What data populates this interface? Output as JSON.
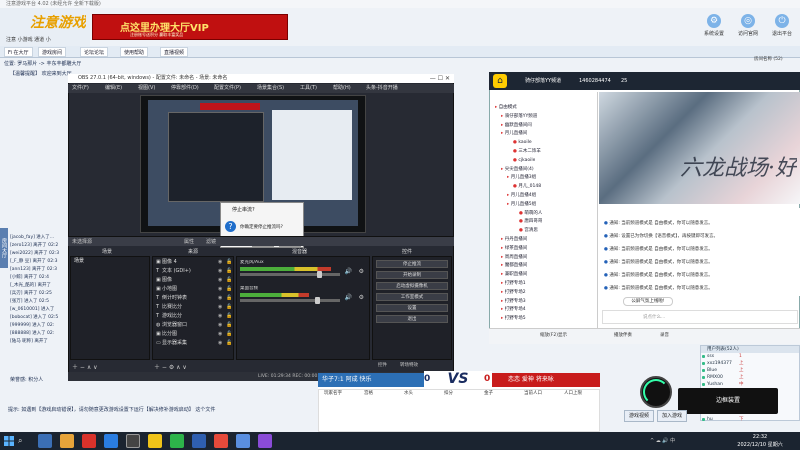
{
  "app": {
    "title": "注意游戏平台 4.02 (未经允许 全新下载版)",
    "logo_text": "注意游戏",
    "logo_sub": "注意 小游戏 通道 小",
    "banner_text": "点这里办理大厅VIP",
    "banner_sub": "注册账号送积分 赢取丰富奖品"
  },
  "topbar": {
    "icons": [
      {
        "label": "系统设置",
        "icon": "gear-icon"
      },
      {
        "label": "访问官网",
        "icon": "globe-icon"
      },
      {
        "label": "退出平台",
        "icon": "exit-icon"
      }
    ]
  },
  "nav": {
    "items": [
      "Fi 在大厅",
      "游戏房间",
      "论坛论坛",
      "使用帮助",
      "直播视频"
    ]
  },
  "breadcrumb": "位置: 罗马那片 -> 丰东丰都雕大厅",
  "notice": "【温馨提醒】 欢迎来到大厅 ...",
  "left": {
    "vtab": "房间大厅",
    "chat": [
      "[jacob_fay] 进入了...",
      "[zero123] 离开了 02:2",
      "[wei2022] 离开了 02:3",
      "[_F_静 豆] 离开了 02:3",
      "[ann123] 离开了 02:3",
      "[小鲸] 离开了 02:4",
      "[_木光_酷的] 离开了",
      "[兵刃] 离开了 02:25",
      "[张万] 进入了 02:5",
      "[w_0610001] 进入了",
      "[bobocat] 进入了 02:5",
      "[999999] 进入了 02:",
      "[888888] 进入了 02:",
      "[陆马 昵称] 离开了"
    ]
  },
  "status": {
    "label": "荣誉感:",
    "value": "积分人"
  },
  "bottom_tip": "提示: 如遇到【游戏启动错误】，请勿随意更改游戏设置下运行【解决修补游戏启动】 这个文件",
  "obs": {
    "title": "OBS 27.0.1 (64-bit, windows) - 配置文件: 未命名 - 场景: 未命名",
    "window_controls": "—  ☐  ✕",
    "menu": [
      "文件(F)",
      "编辑(E)",
      "视图(V)",
      "停靠部件(D)",
      "配置文件(P)",
      "场景集合(S)",
      "工具(T)",
      "帮助(H)",
      "头条-抖音开播"
    ],
    "docks_bar": "未选择源",
    "docks_bar_buttons": [
      "属性",
      "滤镜"
    ],
    "dock_titles": {
      "scenes": "场景",
      "sources": "来源",
      "mixer": "混音器",
      "controls": "控件"
    },
    "scenes": [
      "场景"
    ],
    "sources": [
      {
        "name": "图像 4",
        "icon": "image-icon"
      },
      {
        "name": "文本 (GDI+)",
        "icon": "text-icon"
      },
      {
        "name": "图像",
        "icon": "image-icon"
      },
      {
        "name": "小地图",
        "icon": "image-icon"
      },
      {
        "name": "倒计时钟表",
        "icon": "text-icon"
      },
      {
        "name": "比赛比分",
        "icon": "text-icon"
      },
      {
        "name": "游戏比分",
        "icon": "text-icon"
      },
      {
        "name": "浏览器窗口",
        "icon": "browser-icon"
      },
      {
        "name": "比分图",
        "icon": "image-icon"
      },
      {
        "name": "显示器采集",
        "icon": "monitor-icon"
      }
    ],
    "mixer": [
      {
        "name": "麦克风/Aux",
        "level": 0.72,
        "vol": 0.8
      },
      {
        "name": "桌面音频",
        "level": 0.55,
        "vol": 0.78
      }
    ],
    "controls": [
      "停止推流",
      "开始录制",
      "启动虚拟摄像机",
      "工作室模式",
      "设置",
      "退出"
    ],
    "bottom_tabs": [
      "控件",
      "转场特效"
    ],
    "status": "LIVE: 01:29:34   REC: 00:00:00   CPU: 12.6%, 30.00 fps   kb/s: 2594"
  },
  "dialog": {
    "title": "停止串流?",
    "message": "你确定要停止推流吗?",
    "buttons": [
      "是",
      "否"
    ]
  },
  "yy": {
    "title": "骑仔部落YY频道",
    "channel_id": "1460284474",
    "online": "25",
    "tree": [
      {
        "text": "自由模式",
        "indent": 0
      },
      {
        "text": "骑仔部落YY频道",
        "indent": 1
      },
      {
        "text": "幽默直播间间",
        "indent": 1
      },
      {
        "text": "月儿直播间",
        "indent": 1
      },
      {
        "text": "kaoile",
        "indent": 3
      },
      {
        "text": "三木二饰羊",
        "indent": 3
      },
      {
        "text": "cjkaoile",
        "indent": 3
      },
      {
        "text": "尖尖直播间(4)",
        "indent": 1
      },
      {
        "text": "月儿直播3组",
        "indent": 2
      },
      {
        "text": "月儿_0148",
        "indent": 3
      },
      {
        "text": "月儿直播4组",
        "indent": 2
      },
      {
        "text": "月儿直播5组",
        "indent": 2
      },
      {
        "text": "萌萌的人",
        "indent": 4
      },
      {
        "text": "唐四哥哥",
        "indent": 4
      },
      {
        "text": "宫清思",
        "indent": 4
      },
      {
        "text": "丹丹直播间",
        "indent": 1
      },
      {
        "text": "绿茶直播间",
        "indent": 1
      },
      {
        "text": "周周直播间",
        "indent": 1
      },
      {
        "text": "魔都直播间",
        "indent": 1
      },
      {
        "text": "兼职直播间",
        "indent": 1
      },
      {
        "text": "打野专场1",
        "indent": 1
      },
      {
        "text": "打野专场2",
        "indent": 1
      },
      {
        "text": "打野专场3",
        "indent": 1
      },
      {
        "text": "打野专场4",
        "indent": 1
      },
      {
        "text": "打野专场5",
        "indent": 1
      }
    ],
    "banner_text": "六龙战场·好",
    "messages": [
      "通知: 当前频道模式是 自由模式，你可以随意发言。",
      "通知: 设置已为你切换【语音模式】，再按键即可发言。",
      "通知: 当前频道模式是 自由模式，你可以随意发言。",
      "通知: 当前频道模式是 自由模式，你可以随意发言。",
      "通知: 当前频道模式是 自由模式，你可以随意发言。",
      "通知: 当前频道模式是 自由模式，你可以随意发言。"
    ],
    "welcome": "公屏气氛上线啦!",
    "input_placeholder": "说点什么...",
    "bottom": [
      "缩放(F2)显示",
      "播放伴奏",
      "录音"
    ]
  },
  "scoreboard": {
    "left_team": "华子7:1 阿成 快乐",
    "left_score": "0",
    "vs": "VS",
    "right_score": "0",
    "right_team": "恋恋 爱神 将来咏",
    "cols": [
      "玩家名字",
      "宫格",
      "水头",
      "扣分",
      "金子",
      "当前人口",
      "人口上限"
    ]
  },
  "room": {
    "user_header": "用户列表(52人)",
    "room_tag": "房间名称 (52)",
    "users": [
      {
        "name": "sss",
        "lv": "1"
      },
      {
        "name": "xxz194377",
        "lv": "上"
      },
      {
        "name": "Blue",
        "lv": "上"
      },
      {
        "name": "RMX00",
        "lv": "上"
      },
      {
        "name": "Yushan",
        "lv": "中"
      },
      {
        "name": "hye_cute",
        "lv": "中"
      },
      {
        "name": "changlon",
        "lv": "上"
      },
      {
        "name": "bab",
        "lv": "中"
      },
      {
        "name": "dd222",
        "lv": "中"
      },
      {
        "name": "hu",
        "lv": "下"
      }
    ],
    "fav_btn": "游戏视频",
    "join_btn": "加入游戏"
  },
  "timer": {
    "tip": "边框装置"
  },
  "taskbar": {
    "time": "22:32",
    "date": "2022/12/10 星期六",
    "tray": "^  ☁  🔊  中"
  }
}
